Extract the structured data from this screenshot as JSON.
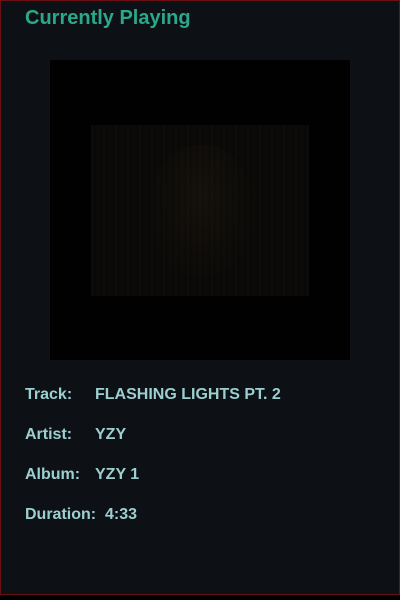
{
  "header": {
    "title": "Currently Playing"
  },
  "album_art": {
    "description_icon": "album-cover-image"
  },
  "details": {
    "track_label": "Track:",
    "track_value": "FLASHING LIGHTS PT. 2",
    "artist_label": "Artist:",
    "artist_value": "YZY",
    "album_label": "Album:",
    "album_value": "YZY 1",
    "duration_label": "Duration:",
    "duration_value": "4:33"
  },
  "colors": {
    "background": "#0d1116",
    "title": "#2aa889",
    "text": "#9ccfcf",
    "border": "#6a0f14"
  }
}
